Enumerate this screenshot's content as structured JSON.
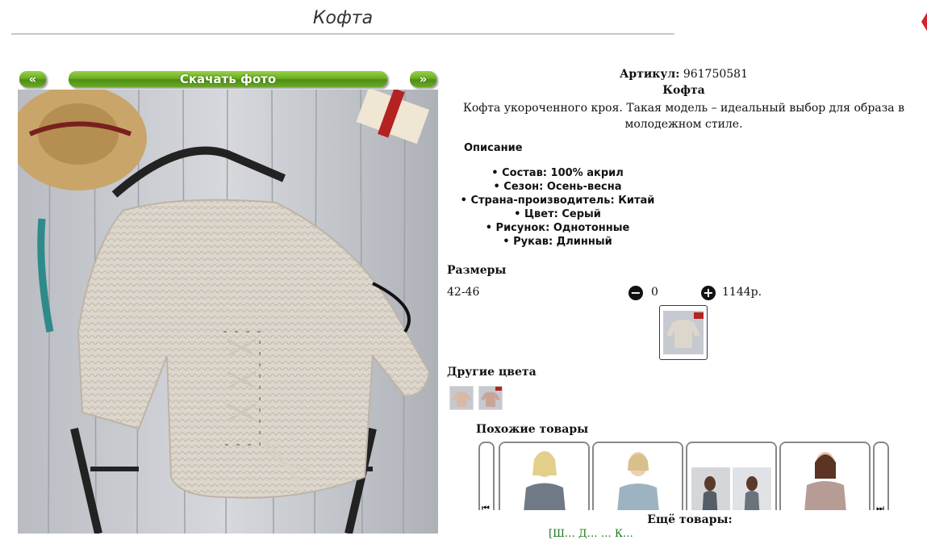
{
  "header": {
    "title": "Кофта"
  },
  "gallery": {
    "prev_label": "«",
    "download_label": "Скачать фото",
    "next_label": "»"
  },
  "product": {
    "article_label": "Артикул:",
    "article_value": "961750581",
    "name": "Кофта",
    "description": "Кофта укороченного кроя. Такая модель – идеальный выбор для образа в молодежном стиле."
  },
  "details": {
    "heading": "Описание",
    "properties": [
      "Состав: 100% акрил",
      "Сезон: Осень-весна",
      "Страна-производитель: Китай",
      "Цвет: Серый",
      "Рисунок: Однотонные",
      "Рукав: Длинный"
    ]
  },
  "sizes": {
    "heading": "Размеры",
    "rows": [
      {
        "size": "42-46",
        "minus": "−",
        "quantity": "0",
        "plus": "+",
        "price": "1144р."
      }
    ]
  },
  "colors": {
    "heading": "Другие цвета"
  },
  "similar": {
    "heading": "Похожие товары",
    "prev": "⏮",
    "next": "⏭"
  },
  "more": {
    "heading": "Ещё товары:",
    "links": "[Ш… Д… … К…"
  },
  "accent_colors": {
    "button_green": "#6cae21",
    "link_green": "#1a7a1a"
  }
}
